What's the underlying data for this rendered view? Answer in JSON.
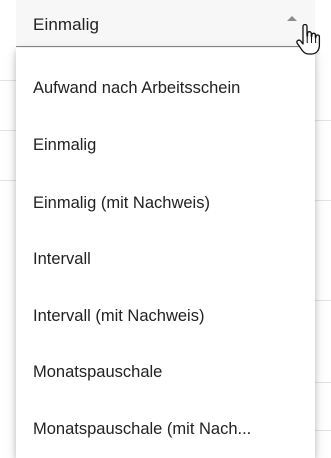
{
  "select": {
    "value": "Einmalig",
    "expanded": true
  },
  "options": [
    "Aufwand nach Arbeitsschein",
    "Einmalig",
    "Einmalig (mit Nachweis)",
    "Intervall",
    "Intervall (mit Nachweis)",
    "Monatspauschale",
    "Monatspauschale (mit Nach..."
  ],
  "icons": {
    "caret": "caret-up-icon",
    "cursor": "hand-pointer-icon"
  },
  "colors": {
    "field_background": "#f7f7f7",
    "field_underline": "#8a8a8a",
    "text": "#222222",
    "caret": "#8c8c8c",
    "panel_background": "#ffffff"
  }
}
